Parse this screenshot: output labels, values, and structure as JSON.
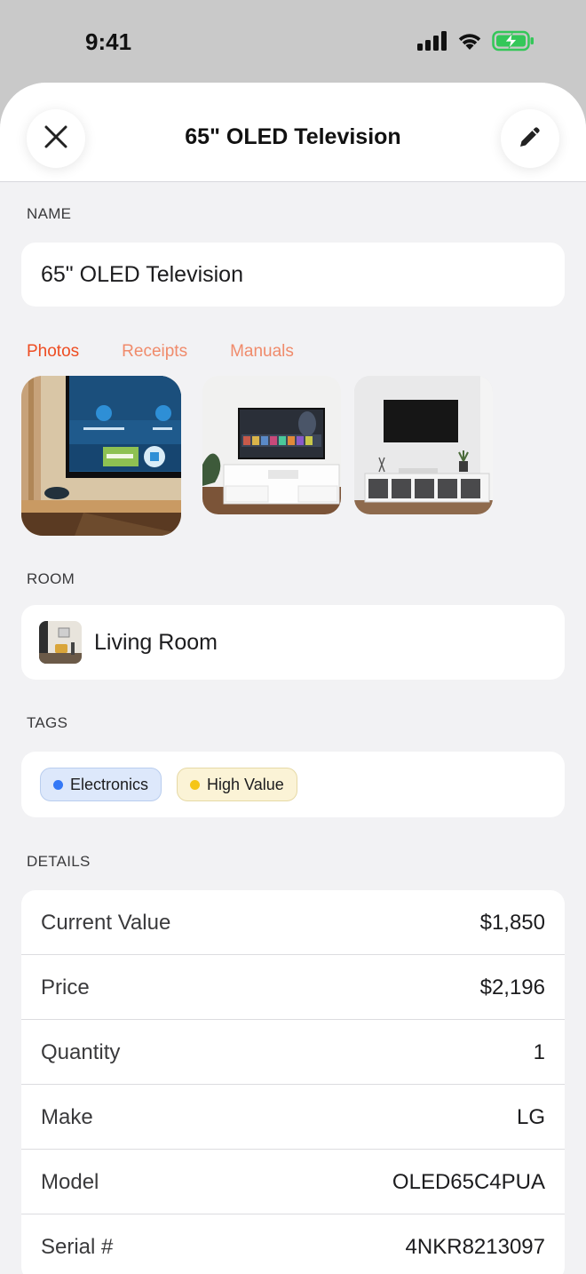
{
  "status_bar": {
    "time": "9:41",
    "icons": [
      "cellular-signal-icon",
      "wifi-icon",
      "battery-charging-icon"
    ]
  },
  "header": {
    "title": "65\" OLED Television",
    "close_icon": "close-icon",
    "edit_icon": "pencil-icon"
  },
  "name_section": {
    "label": "NAME",
    "value": "65\" OLED Television"
  },
  "media_tabs": [
    {
      "label": "Photos",
      "active": true
    },
    {
      "label": "Receipts",
      "active": false
    },
    {
      "label": "Manuals",
      "active": false
    }
  ],
  "photos": [
    {
      "name": "tv-on-shelf-photo"
    },
    {
      "name": "tv-on-white-stand-photo"
    },
    {
      "name": "wall-mounted-tv-photo"
    }
  ],
  "room_section": {
    "label": "ROOM",
    "value": "Living Room"
  },
  "tags_section": {
    "label": "TAGS",
    "tags": [
      {
        "label": "Electronics",
        "dot_color": "#3478f6",
        "bg_color": "#dde8fb",
        "border_color": "#b9cdee"
      },
      {
        "label": "High Value",
        "dot_color": "#f5c518",
        "bg_color": "#fbf3d6",
        "border_color": "#e6d9a6"
      }
    ]
  },
  "details_section": {
    "label": "DETAILS",
    "rows": [
      {
        "label": "Current Value",
        "value": "$1,850"
      },
      {
        "label": "Price",
        "value": "$2,196"
      },
      {
        "label": "Quantity",
        "value": "1"
      },
      {
        "label": "Make",
        "value": "LG"
      },
      {
        "label": "Model",
        "value": "OLED65C4PUA"
      },
      {
        "label": "Serial #",
        "value": "4NKR8213097"
      }
    ]
  },
  "colors": {
    "accent": "#ee4d22",
    "accent_muted": "#f08b6b",
    "battery": "#34c759"
  }
}
